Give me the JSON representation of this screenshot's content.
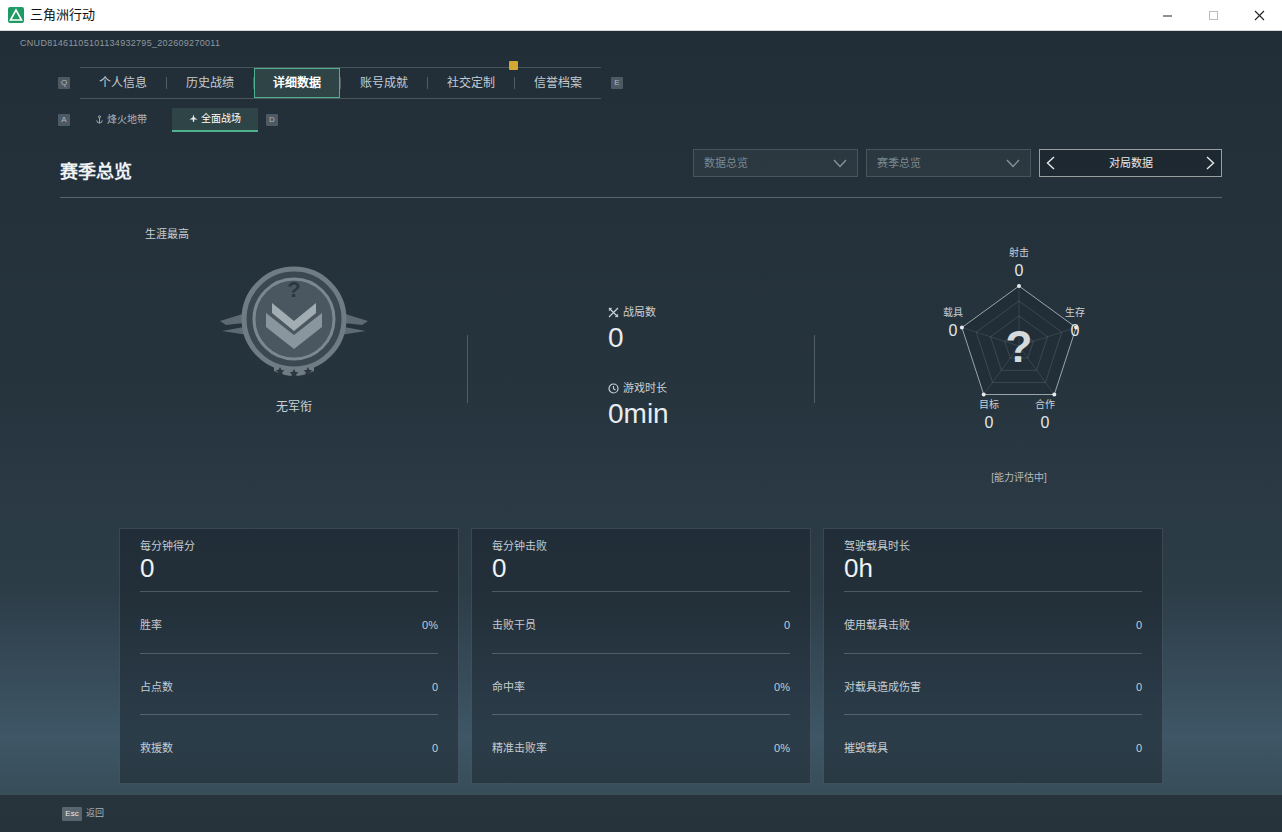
{
  "window": {
    "title": "三角洲行动"
  },
  "player_id": "CNUD81461105101134932795_202609270011",
  "tabs": {
    "prev_key": "Q",
    "next_key": "E",
    "items": [
      {
        "label": "个人信息",
        "selected": false,
        "alert": false
      },
      {
        "label": "历史战绩",
        "selected": false,
        "alert": false
      },
      {
        "label": "详细数据",
        "selected": true,
        "alert": false
      },
      {
        "label": "账号成就",
        "selected": false,
        "alert": false
      },
      {
        "label": "社交定制",
        "selected": false,
        "alert": true
      },
      {
        "label": "信誉档案",
        "selected": false,
        "alert": false
      }
    ]
  },
  "modes": {
    "prev_key": "A",
    "next_key": "D",
    "items": [
      {
        "label": "烽火地带",
        "selected": false
      },
      {
        "label": "全面战场",
        "selected": true
      }
    ]
  },
  "overview": {
    "title": "赛季总览",
    "filters": [
      {
        "label": "数据总览"
      },
      {
        "label": "赛季总览"
      }
    ],
    "pager": {
      "label": "对局数据"
    }
  },
  "rank": {
    "caption": "生涯最高",
    "emblem": "?",
    "name": "无军衔"
  },
  "summary": [
    {
      "label": "战局数",
      "value": "0"
    },
    {
      "label": "游戏时长",
      "value": "0min"
    }
  ],
  "radar": {
    "center": "?",
    "status": "[能力评估中]",
    "axes": [
      {
        "label": "射击",
        "value": "0"
      },
      {
        "label": "生存",
        "value": "0"
      },
      {
        "label": "合作",
        "value": "0"
      },
      {
        "label": "目标",
        "value": "0"
      },
      {
        "label": "载具",
        "value": "0"
      }
    ]
  },
  "cards": [
    {
      "title": "每分钟得分",
      "value": "0",
      "rows": [
        {
          "label": "胜率",
          "value": "0%"
        },
        {
          "label": "占点数",
          "value": "0"
        },
        {
          "label": "救援数",
          "value": "0"
        }
      ]
    },
    {
      "title": "每分钟击败",
      "value": "0",
      "rows": [
        {
          "label": "击败干员",
          "value": "0"
        },
        {
          "label": "命中率",
          "value": "0%"
        },
        {
          "label": "精准击败率",
          "value": "0%"
        }
      ]
    },
    {
      "title": "驾驶载具时长",
      "value": "0h",
      "rows": [
        {
          "label": "使用载具击败",
          "value": "0"
        },
        {
          "label": "对载具造成伤害",
          "value": "0"
        },
        {
          "label": "摧毁载具",
          "value": "0"
        }
      ]
    }
  ],
  "footer": {
    "key": "Esc",
    "label": "返回"
  }
}
